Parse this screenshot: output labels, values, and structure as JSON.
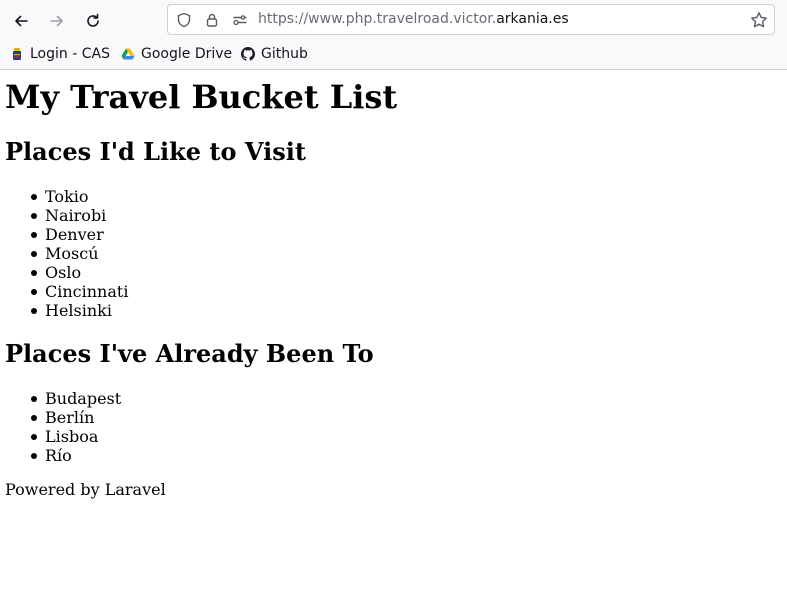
{
  "browser": {
    "url_prefix": "https://www.php.travelroad.victor.",
    "url_domain": "arkania.es",
    "bookmarks": [
      {
        "label": "Login - CAS",
        "icon": "cas-logo-icon"
      },
      {
        "label": "Google Drive",
        "icon": "google-drive-icon"
      },
      {
        "label": "Github",
        "icon": "github-icon"
      }
    ]
  },
  "page": {
    "title": "My Travel Bucket List",
    "wishlist": {
      "heading": "Places I'd Like to Visit",
      "items": [
        "Tokio",
        "Nairobi",
        "Denver",
        "Moscú",
        "Oslo",
        "Cincinnati",
        "Helsinki"
      ]
    },
    "visited": {
      "heading": "Places I've Already Been To",
      "items": [
        "Budapest",
        "Berlín",
        "Lisboa",
        "Río"
      ]
    },
    "footer": "Powered by Laravel"
  }
}
